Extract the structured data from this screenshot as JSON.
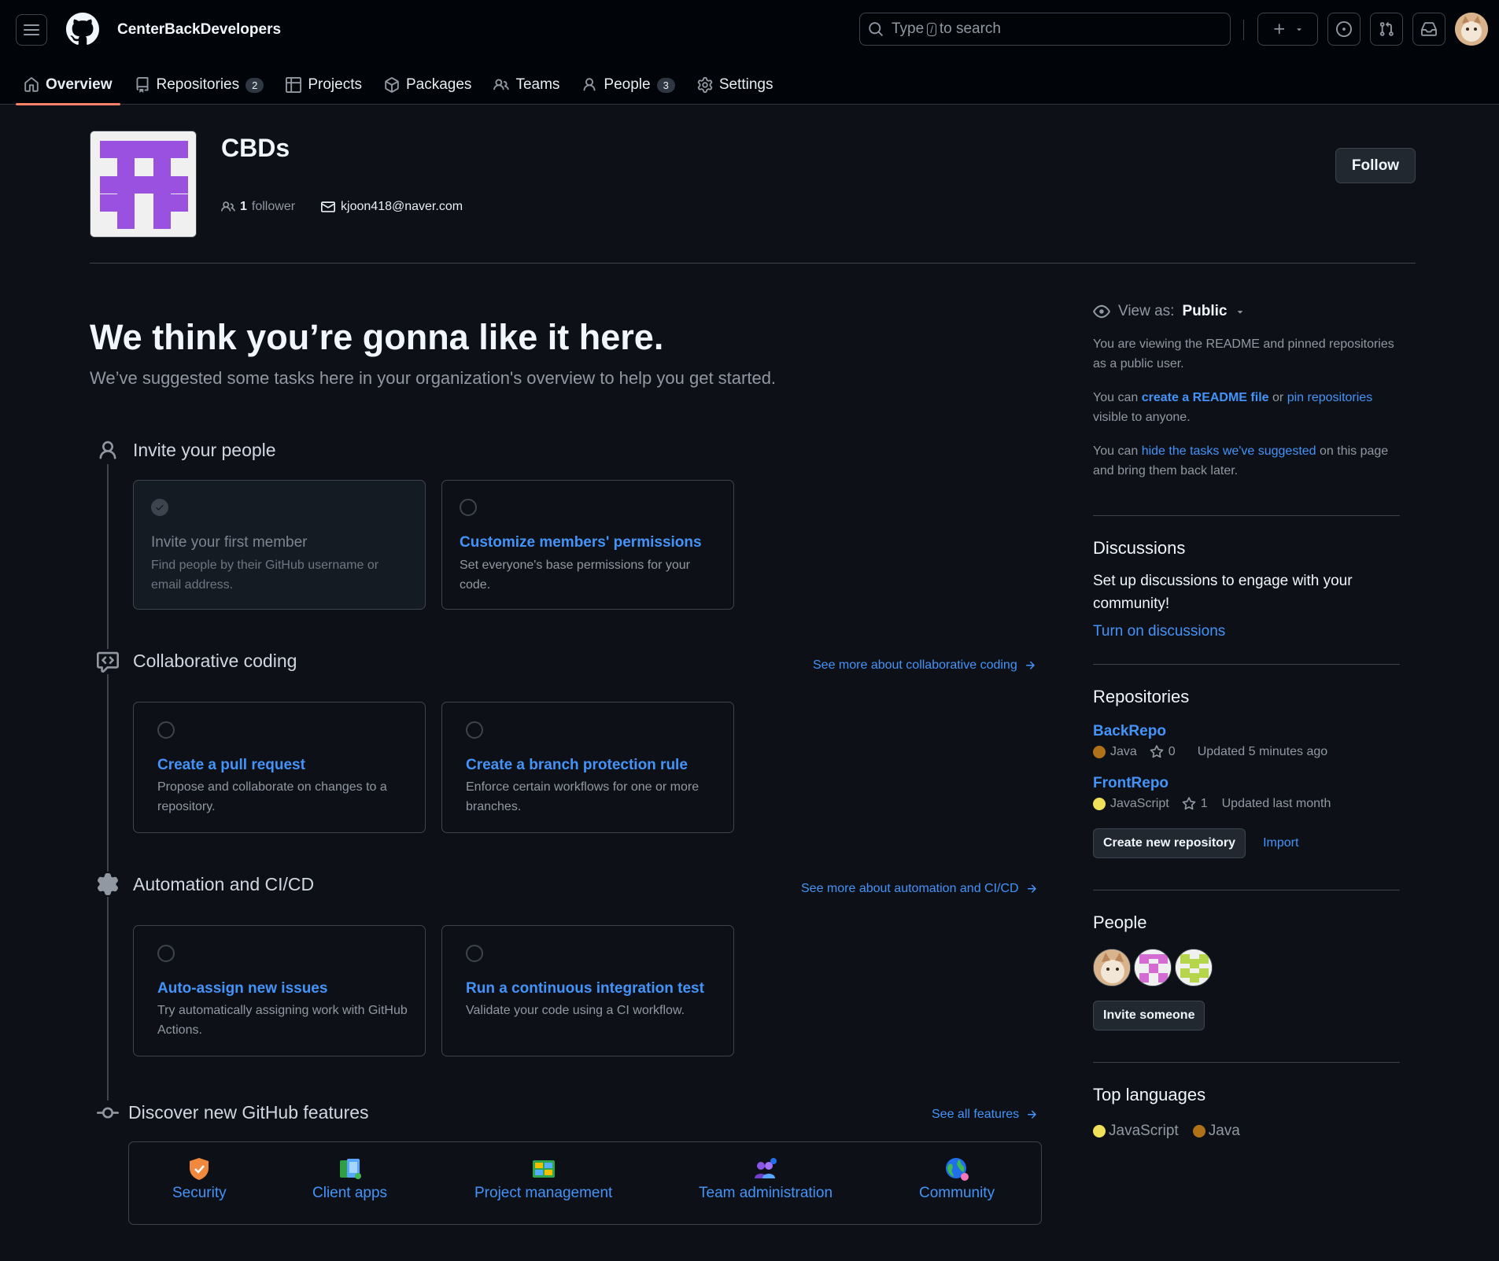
{
  "header": {
    "org_name": "CenterBackDevelopers",
    "search_prefix": "Type",
    "search_key": "/",
    "search_suffix": "to search"
  },
  "nav": {
    "overview": "Overview",
    "repositories": "Repositories",
    "repositories_count": "2",
    "projects": "Projects",
    "packages": "Packages",
    "teams": "Teams",
    "people": "People",
    "people_count": "3",
    "settings": "Settings"
  },
  "org": {
    "title": "CBDs",
    "followers_count": "1",
    "followers_label": "follower",
    "email": "kjoon418@naver.com",
    "follow_button": "Follow"
  },
  "main": {
    "headline": "We think you’re gonna like it here.",
    "subline": "We’ve suggested some tasks here in your organization's overview to help you get started.",
    "sections": {
      "invite": {
        "title": "Invite your people",
        "cards": [
          {
            "title": "Invite your first member",
            "desc": "Find people by their GitHub username or email address.",
            "done": true
          },
          {
            "title": "Customize members' permissions",
            "desc": "Set everyone's base permissions for your code.",
            "done": false
          }
        ]
      },
      "collab": {
        "title": "Collaborative coding",
        "link": "See more about collaborative coding",
        "cards": [
          {
            "title": "Create a pull request",
            "desc": "Propose and collaborate on changes to a repository."
          },
          {
            "title": "Create a branch protection rule",
            "desc": "Enforce certain workflows for one or more branches."
          }
        ]
      },
      "automation": {
        "title": "Automation and CI/CD",
        "link": "See more about automation and CI/CD",
        "cards": [
          {
            "title": "Auto-assign new issues",
            "desc": "Try automatically assigning work with GitHub Actions."
          },
          {
            "title": "Run a continuous integration test",
            "desc": "Validate your code using a CI workflow."
          }
        ]
      },
      "discover": {
        "title": "Discover new GitHub features",
        "link": "See all features",
        "features": [
          "Security",
          "Client apps",
          "Project management",
          "Team administration",
          "Community"
        ]
      }
    }
  },
  "sidebar": {
    "view_as_label": "View as:",
    "view_as_value": "Public",
    "viewing_text": "You are viewing the README and pinned repositories as a public user.",
    "can_prefix": "You can",
    "create_readme": "create a README file",
    "or": "or",
    "pin_repos": "pin repositories",
    "visible": "visible to anyone.",
    "can_prefix2": "You can",
    "hide_tasks": "hide the tasks we've suggested",
    "hide_suffix": "on this page and bring them back later.",
    "discussions": {
      "title": "Discussions",
      "text": "Set up discussions to engage with your community!",
      "link": "Turn on discussions"
    },
    "repositories": {
      "title": "Repositories",
      "items": [
        {
          "name": "BackRepo",
          "language": "Java",
          "lang_color": "#b07219",
          "stars": "0",
          "updated": "Updated 5 minutes ago"
        },
        {
          "name": "FrontRepo",
          "language": "JavaScript",
          "lang_color": "#f1e05a",
          "stars": "1",
          "updated": "Updated last month"
        }
      ],
      "create_button": "Create new repository",
      "import_link": "Import"
    },
    "people": {
      "title": "People",
      "invite_button": "Invite someone"
    },
    "languages": {
      "title": "Top languages",
      "items": [
        {
          "name": "JavaScript",
          "color": "#f1e05a"
        },
        {
          "name": "Java",
          "color": "#b07219"
        }
      ]
    }
  }
}
